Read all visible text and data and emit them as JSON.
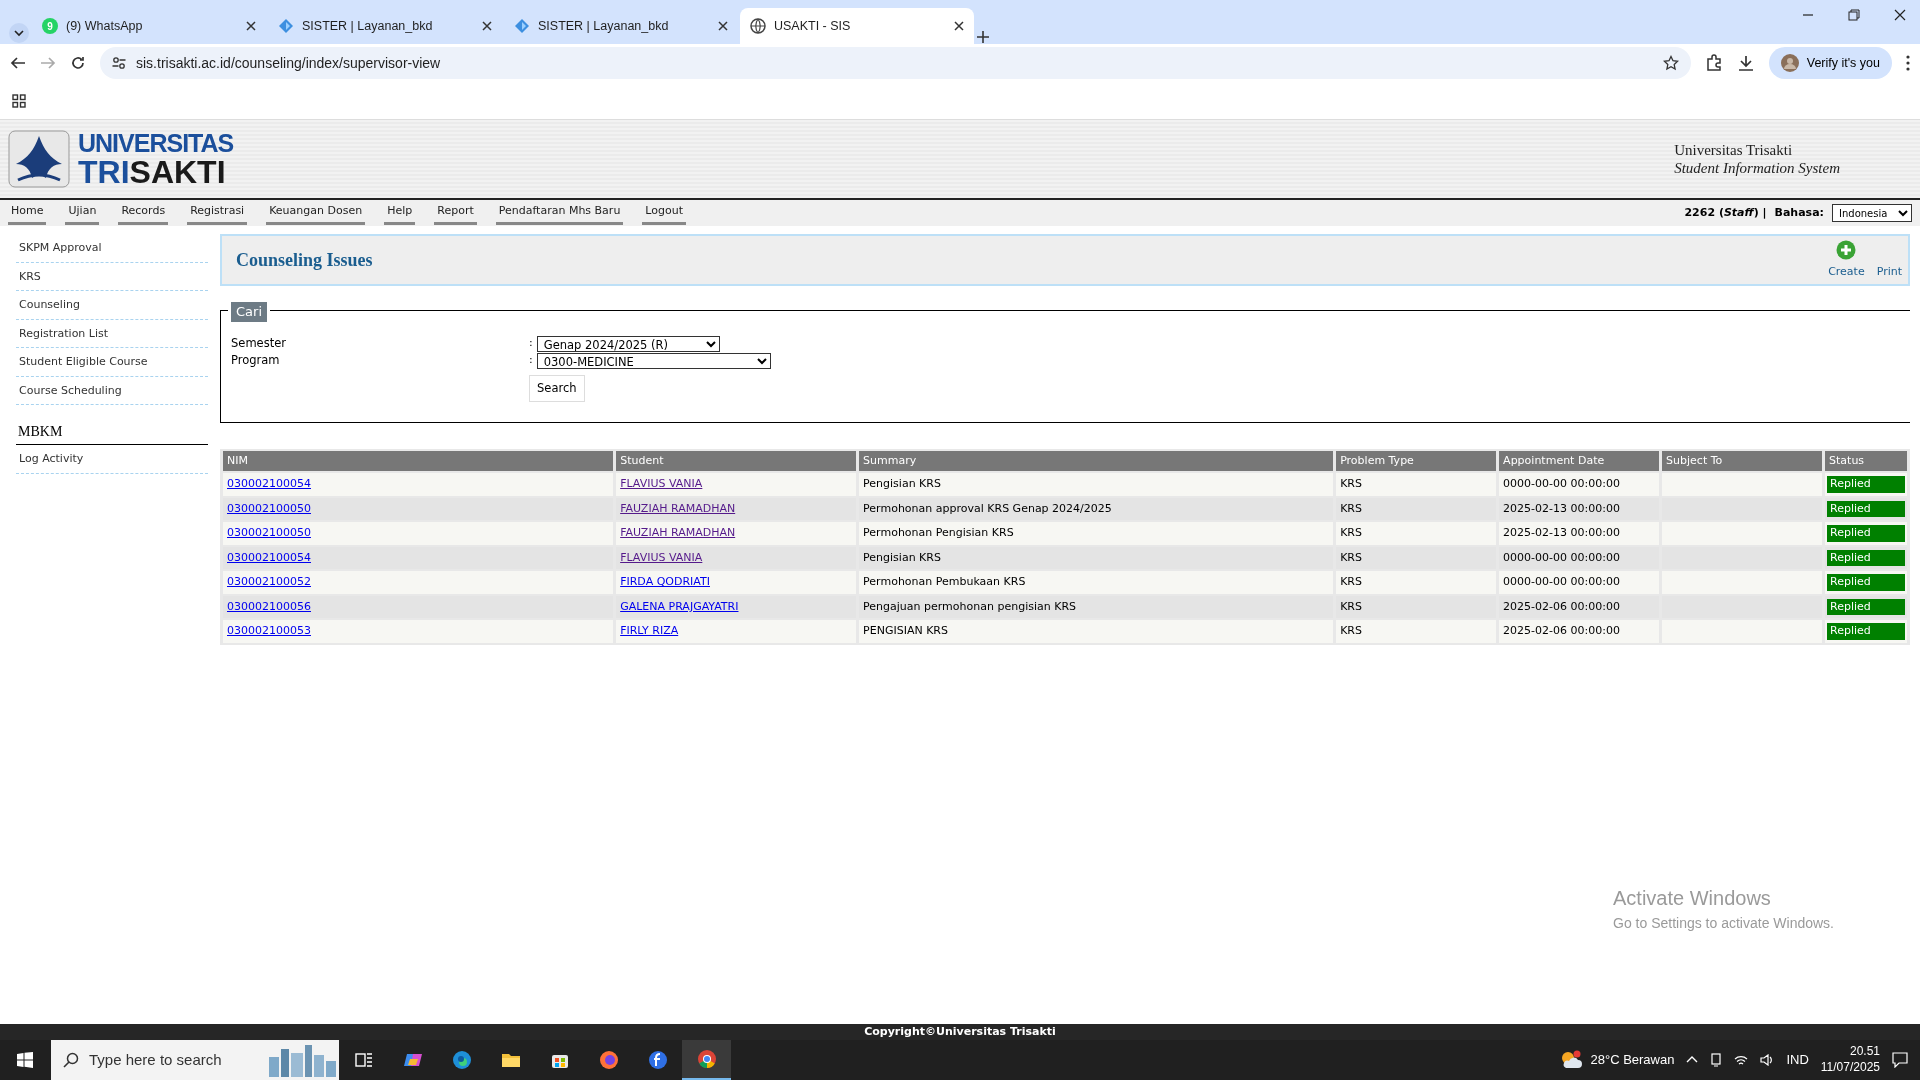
{
  "browser": {
    "tabs": [
      {
        "title": "(9) WhatsApp",
        "kind": "whatsapp",
        "badge": "9",
        "selected": false
      },
      {
        "title": "SISTER | Layanan_bkd",
        "kind": "diamond",
        "selected": false
      },
      {
        "title": "SISTER | Layanan_bkd",
        "kind": "diamond",
        "selected": false
      },
      {
        "title": "USAKTI - SIS",
        "kind": "globe",
        "selected": true
      }
    ],
    "address": "sis.trisakti.ac.id/counseling/index/supervisor-view",
    "profile_button": "Verify it's you"
  },
  "header": {
    "logo_top": "UNIVERSITAS",
    "logo_bottom_a": "TRI",
    "logo_bottom_b": "SAKTI",
    "site_name": "Universitas Trisakti",
    "site_subtitle": "Student Information System"
  },
  "nav": {
    "items": [
      "Home",
      "Ujian",
      "Records",
      "Registrasi",
      "Keuangan Dosen",
      "Help",
      "Report",
      "Pendaftaran Mhs Baru",
      "Logout"
    ],
    "user": "2262 (*Staff*) |",
    "language_label": "Bahasa:",
    "language": "Indonesia"
  },
  "sidebar": {
    "items": [
      "SKPM Approval",
      "KRS",
      "Counseling",
      "Registration List",
      "Student Eligible Course",
      "Course Scheduling"
    ],
    "section": "MBKM",
    "section_items": [
      "Log Activity"
    ]
  },
  "page": {
    "title": "Counseling Issues",
    "actions": [
      {
        "label": "Create",
        "kind": "create"
      },
      {
        "label": "Print",
        "kind": "print"
      }
    ]
  },
  "search": {
    "legend": "Cari",
    "fields": [
      {
        "label": "Semester",
        "separator": ":",
        "value": "Genap 2024/2025 (R)"
      },
      {
        "label": "Program",
        "separator": ":",
        "value": "0300-MEDICINE"
      }
    ],
    "button": "Search"
  },
  "table": {
    "columns": [
      "NIM",
      "Student",
      "Summary",
      "Problem Type",
      "Appointment Date",
      "Subject To",
      "Status"
    ],
    "rows": [
      {
        "nim": "030002100054",
        "student": "FLAVIUS VANIA",
        "visited": true,
        "summary": "Pengisian KRS",
        "problem_type": "KRS",
        "appointment_date": "0000-00-00 00:00:00",
        "status": "Replied",
        "color": "#008000"
      },
      {
        "nim": "030002100050",
        "student": "FAUZIAH RAMADHAN",
        "visited": true,
        "summary": "Permohonan approval KRS Genap 2024/2025",
        "problem_type": "KRS",
        "appointment_date": "2025-02-13 00:00:00",
        "status": "Replied",
        "color": "#008000"
      },
      {
        "nim": "030002100050",
        "student": "FAUZIAH RAMADHAN",
        "visited": true,
        "summary": "Permohonan Pengisian KRS",
        "problem_type": "KRS",
        "appointment_date": "2025-02-13 00:00:00",
        "status": "Replied",
        "color": "#008000"
      },
      {
        "nim": "030002100054",
        "student": "FLAVIUS VANIA",
        "visited": true,
        "summary": "Pengisian KRS",
        "problem_type": "KRS",
        "appointment_date": "0000-00-00 00:00:00",
        "status": "Replied",
        "color": "#008000"
      },
      {
        "nim": "030002100052",
        "student": "FIRDA QODRIATI",
        "visited": false,
        "summary": "Permohonan Pembukaan KRS",
        "problem_type": "KRS",
        "appointment_date": "0000-00-00 00:00:00",
        "status": "Replied",
        "color": "#008000"
      },
      {
        "nim": "030002100056",
        "student": "GALENA PRAJGAYATRI",
        "visited": false,
        "summary": "Pengajuan permohonan pengisian KRS",
        "problem_type": "KRS",
        "appointment_date": "2025-02-06 00:00:00",
        "status": "Replied",
        "color": "#008000"
      },
      {
        "nim": "030002100053",
        "student": "FIRLY RIZA",
        "visited": false,
        "summary": "PENGISIAN KRS",
        "problem_type": "KRS",
        "appointment_date": "2025-02-06 00:00:00",
        "status": "Replied",
        "color": "#008000"
      }
    ]
  },
  "activation_notice": {
    "title": "Activate Windows",
    "text": "Go to Settings to activate Windows."
  },
  "footer": "Copyright©Universitas Trisakti",
  "taskbar": {
    "search_placeholder": "Type here to search",
    "apps": [
      {
        "kind": "taskview",
        "selected": false
      },
      {
        "kind": "copilot",
        "selected": false
      },
      {
        "kind": "edge",
        "selected": false
      },
      {
        "kind": "folder",
        "selected": false
      },
      {
        "kind": "store",
        "selected": false
      },
      {
        "kind": "firefox",
        "selected": false
      },
      {
        "kind": "fapp",
        "selected": false
      },
      {
        "kind": "chrome",
        "selected": true
      }
    ],
    "weather": "28°C Berawan",
    "language": "IND",
    "time": "20.51",
    "date": "11/07/2025"
  }
}
